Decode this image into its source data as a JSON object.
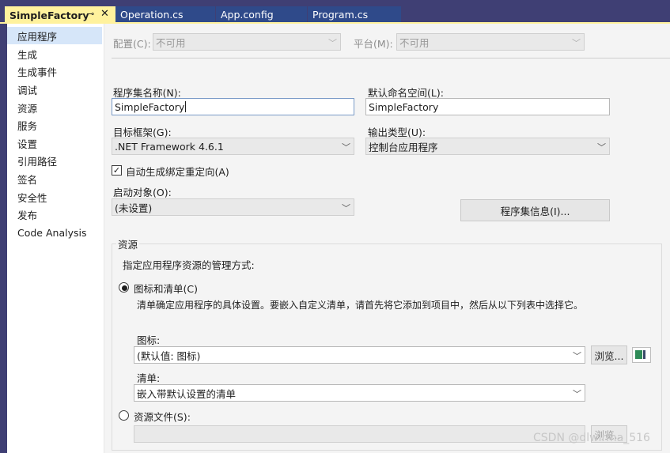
{
  "tabs": {
    "active": "SimpleFactory",
    "active_pin": "⊸",
    "active_close": "✕",
    "others": [
      "Operation.cs",
      "App.config",
      "Program.cs"
    ]
  },
  "sidebar": {
    "items": [
      {
        "label": "应用程序",
        "selected": true
      },
      {
        "label": "生成"
      },
      {
        "label": "生成事件"
      },
      {
        "label": "调试"
      },
      {
        "label": "资源"
      },
      {
        "label": "服务"
      },
      {
        "label": "设置"
      },
      {
        "label": "引用路径"
      },
      {
        "label": "签名"
      },
      {
        "label": "安全性"
      },
      {
        "label": "发布"
      },
      {
        "label": "Code Analysis"
      }
    ]
  },
  "config_bar": {
    "config_label": "配置(C):",
    "config_value": "不可用",
    "platform_label": "平台(M):",
    "platform_value": "不可用"
  },
  "form": {
    "assembly_name_label": "程序集名称(N):",
    "assembly_name_value": "SimpleFactory",
    "default_namespace_label": "默认命名空间(L):",
    "default_namespace_value": "SimpleFactory",
    "target_framework_label": "目标框架(G):",
    "target_framework_value": ".NET Framework 4.6.1",
    "output_type_label": "输出类型(U):",
    "output_type_value": "控制台应用程序",
    "auto_binding_label": "自动生成绑定重定向(A)",
    "auto_binding_checked": true,
    "startup_object_label": "启动对象(O):",
    "startup_object_value": "(未设置)",
    "assembly_info_button": "程序集信息(I)..."
  },
  "resources": {
    "group_title": "资源",
    "instructions": "指定应用程序资源的管理方式:",
    "icon_manifest_radio": "图标和清单(C)",
    "icon_manifest_checked": true,
    "icon_manifest_desc": "清单确定应用程序的具体设置。要嵌入自定义清单，请首先将它添加到项目中，然后从以下列表中选择它。",
    "icon_label": "图标:",
    "icon_value": "(默认值: 图标)",
    "browse_button": "浏览...",
    "manifest_label": "清单:",
    "manifest_value": "嵌入带默认设置的清单",
    "resource_file_radio": "资源文件(S):",
    "resource_file_checked": false,
    "resource_file_value": "",
    "resource_browse_button": "浏览..."
  },
  "watermark": "CSDN @dlwlrma_516",
  "colors": {
    "tab_bar": "#3f3f74",
    "active_tab": "#fff29d",
    "sidebar_selected": "#d6e6f9",
    "content_bg": "#f4f4f4"
  }
}
